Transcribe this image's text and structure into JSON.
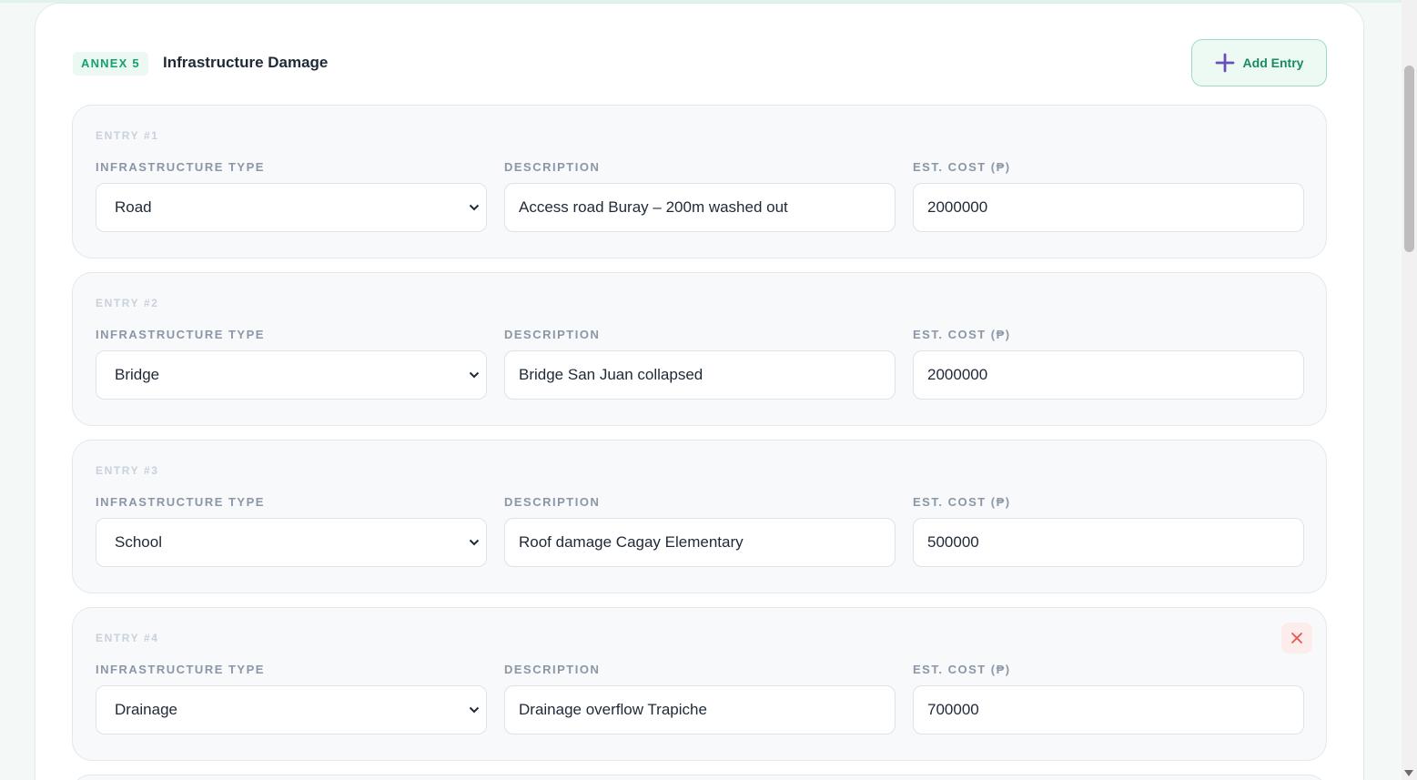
{
  "section": {
    "annex_badge": "ANNEX 5",
    "title": "Infrastructure Damage",
    "add_button_label": "Add Entry",
    "add_icon": "plus-icon",
    "accent_color": "#14a06f",
    "add_icon_color": "#6b4fb8"
  },
  "labels": {
    "type": "INFRASTRUCTURE TYPE",
    "description": "DESCRIPTION",
    "cost": "EST. COST (₱)"
  },
  "entries": [
    {
      "label": "ENTRY #1",
      "type": "Road",
      "description": "Access road Buray – 200m washed out",
      "cost": "2000000"
    },
    {
      "label": "ENTRY #2",
      "type": "Bridge",
      "description": "Bridge San Juan collapsed",
      "cost": "2000000"
    },
    {
      "label": "ENTRY #3",
      "type": "School",
      "description": "Roof damage Cagay Elementary",
      "cost": "500000"
    },
    {
      "label": "ENTRY #4",
      "type": "Drainage",
      "description": "Drainage overflow Trapiche",
      "cost": "700000",
      "removable": true,
      "remove_icon": "close-icon"
    }
  ]
}
